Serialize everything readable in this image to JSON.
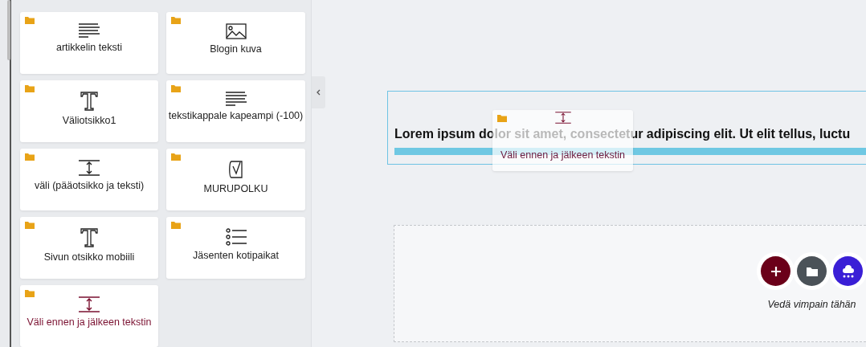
{
  "widgets": [
    {
      "label": "artikkelin teksti",
      "kind": "paragraph",
      "selected": false
    },
    {
      "label": "Blogin kuva",
      "kind": "image",
      "selected": false
    },
    {
      "label": "Väliotsikko1",
      "kind": "heading",
      "selected": false
    },
    {
      "label": "tekstikappale kapeampi (-100)",
      "kind": "paragraph",
      "selected": false
    },
    {
      "label": "väli (pääotsikko ja teksti)",
      "kind": "spacer",
      "selected": false
    },
    {
      "label": "MURUPOLKU",
      "kind": "breadcrumb",
      "selected": false
    },
    {
      "label": "Sivun otsikko mobiili",
      "kind": "heading",
      "selected": false
    },
    {
      "label": "Jäsenten kotipaikat",
      "kind": "list",
      "selected": false
    },
    {
      "label": "Väli ennen ja jälkeen tekstin",
      "kind": "spacer",
      "selected": true
    }
  ],
  "section": {
    "text": "Lorem ipsum dolor sit amet, consectetur adipiscing elit. Ut elit tellus, luctu"
  },
  "drag_preview": {
    "label": "Väli ennen ja jälkeen tekstin",
    "kind": "spacer"
  },
  "dropzone": {
    "buttons": [
      {
        "kind": "add",
        "color": "#6b0019"
      },
      {
        "kind": "folder",
        "color": "#4b5258"
      },
      {
        "kind": "cloud",
        "color": "#3a1fd6"
      }
    ],
    "caption": "Vedä vimpain tähän"
  }
}
